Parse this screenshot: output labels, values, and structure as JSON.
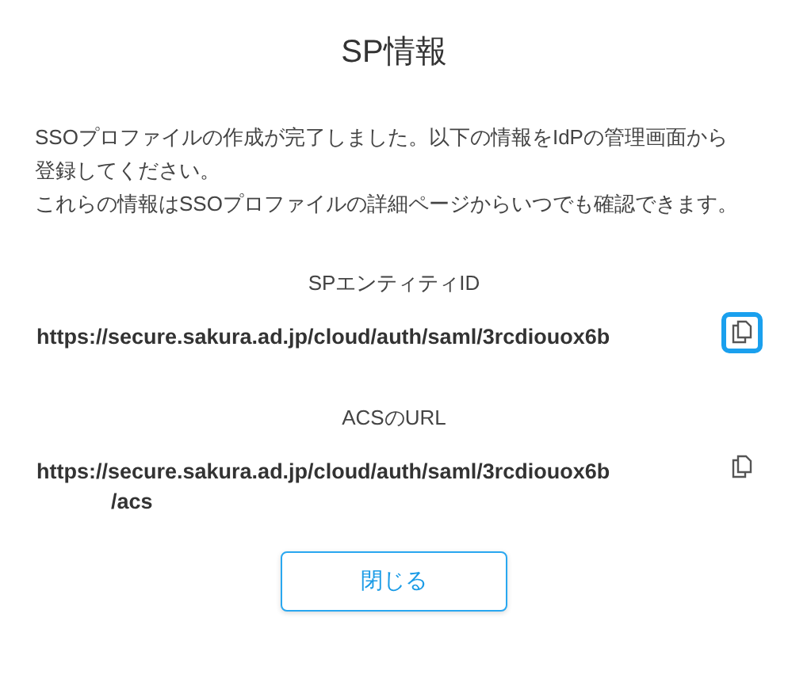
{
  "title": "SP情報",
  "message_lines": [
    "SSOプロファイルの作成が完了しました。以下の情報をIdPの管理画面から",
    "登録してください。",
    "これらの情報はSSOプロファイルの詳細ページからいつでも確認できます。"
  ],
  "fields": [
    {
      "label": "SPエンティティID",
      "value_lines": [
        "https://secure.sakura.ad.jp/cloud/auth/saml/3rcdiouox6b"
      ],
      "copy_focused": true
    },
    {
      "label": "ACSのURL",
      "value_lines": [
        "https://secure.sakura.ad.jp/cloud/auth/saml/3rcdiouox6b",
        "/acs"
      ],
      "copy_focused": false
    }
  ],
  "close_button": "閉じる"
}
